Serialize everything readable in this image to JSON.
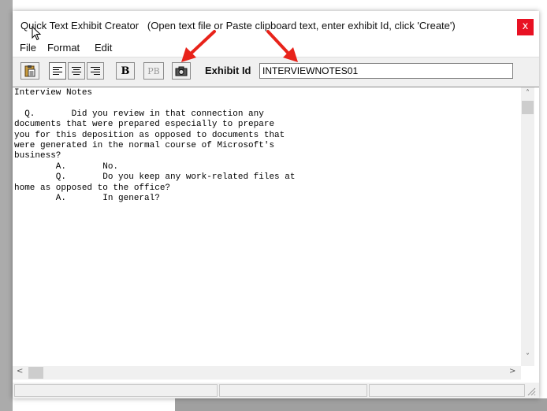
{
  "window": {
    "title": "Quick Text Exhibit Creator",
    "subtitle": "(Open text file or Paste clipboard text, enter exhibit Id, click 'Create')",
    "close_label": "x"
  },
  "menu": [
    "File",
    "Format",
    "Edit"
  ],
  "toolbar": {
    "bold_label": "B",
    "pb_label": "PB",
    "exhibit_label": "Exhibit Id",
    "exhibit_value": "INTERVIEWNOTES01"
  },
  "editor": {
    "lines": [
      "Interview Notes",
      "",
      "  Q.       Did you review in that connection any",
      "documents that were prepared especially to prepare",
      "you for this deposition as opposed to documents that",
      "were generated in the normal course of Microsoft's",
      "business?",
      "        A.       No.",
      "        Q.       Do you keep any work-related files at",
      "home as opposed to the office?",
      "        A.       In general?"
    ]
  },
  "colors": {
    "close": "#e81123",
    "annotation_arrow": "#e8231a"
  }
}
